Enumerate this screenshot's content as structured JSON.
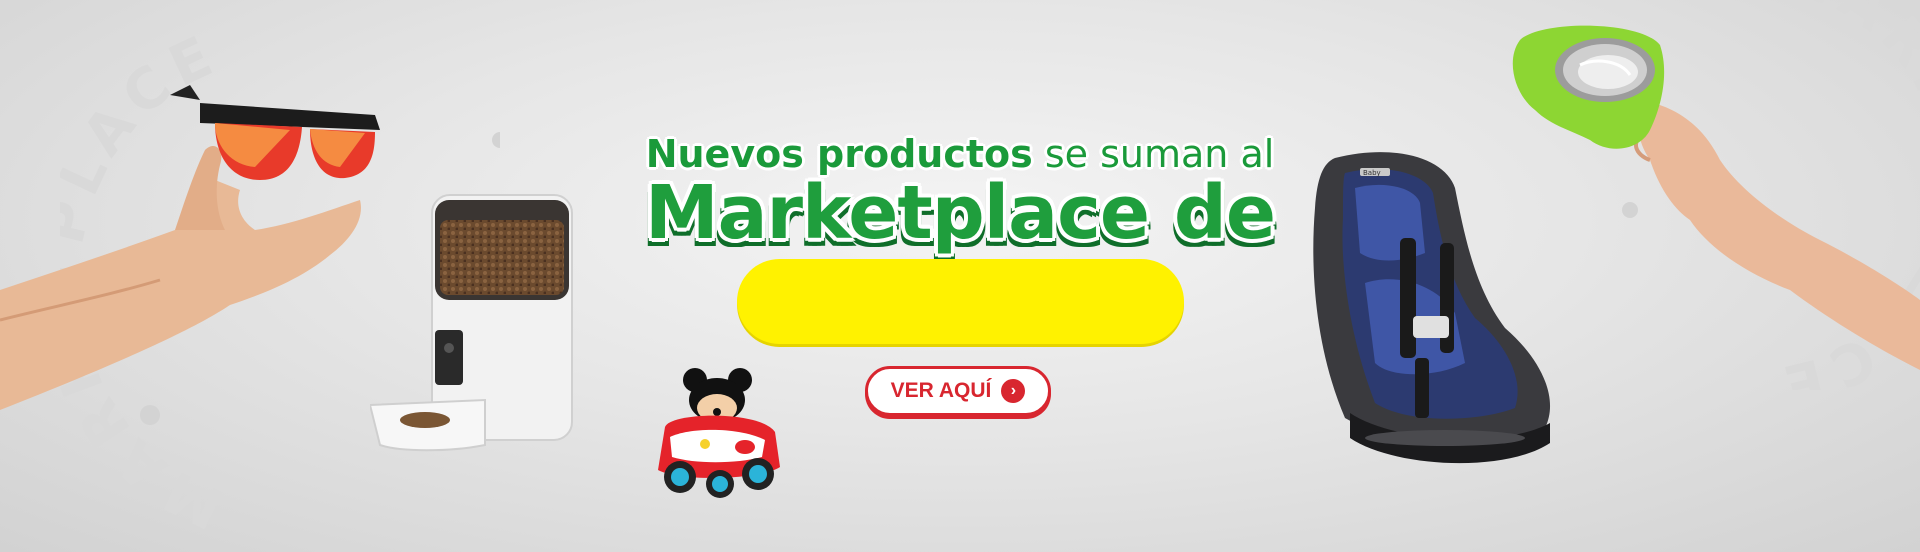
{
  "banner": {
    "headline_bold": "Nuevos productos",
    "headline_rest": " se suman al",
    "title": "Marketplace de",
    "cta_label": "VER AQUÍ",
    "watermark_text": "MARKETPLACE",
    "brand_yellow": "#fff200",
    "brand_green": "#1f9e3d",
    "cta_red": "#d8262f"
  },
  "products": [
    {
      "name": "sunglasses",
      "icon": "sunglasses-icon"
    },
    {
      "name": "pet-feeder",
      "icon": "pet-feeder-icon"
    },
    {
      "name": "toy-car",
      "icon": "toy-car-icon"
    },
    {
      "name": "car-seat",
      "icon": "car-seat-icon"
    },
    {
      "name": "pet-bowl",
      "icon": "pet-bowl-icon"
    }
  ],
  "seat_brand_label": "Baby"
}
